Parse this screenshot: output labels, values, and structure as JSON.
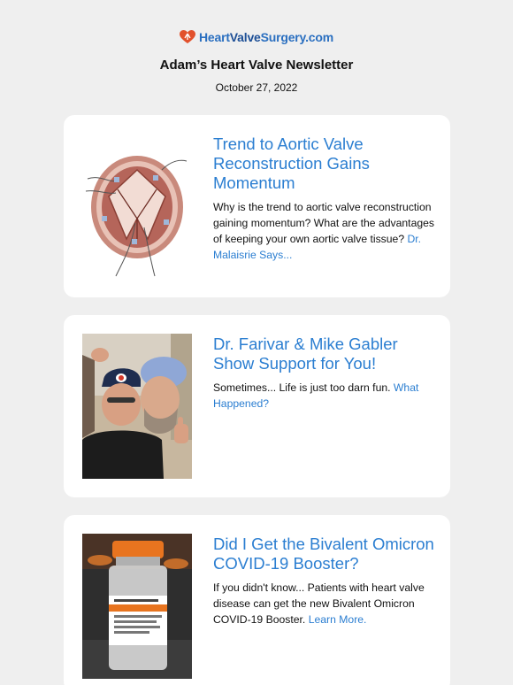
{
  "header": {
    "logo": {
      "part1": "Heart",
      "part2": "Valve",
      "part3": "Surgery.com",
      "icon": "heart-valve-logo-icon",
      "color_primary": "#2a6fc0",
      "color_icon": "#e2512c"
    },
    "title": "Adam’s Heart Valve Newsletter",
    "date": "October 27, 2022"
  },
  "articles": [
    {
      "headline": "Trend to Aortic Valve Reconstruction Gains Momentum",
      "body": "Why is the trend to aortic valve reconstruction gaining momentum? What are the advantages of keeping your own aortic valve tissue?",
      "link": "Dr. Malaisrie Says...",
      "image": "aortic-valve-illustration"
    },
    {
      "headline": "Dr. Farivar & Mike Gabler Show Support for You!",
      "body": "Sometimes... Life is just too darn fun.",
      "link": "What Happened?",
      "image": "doctors-selfie-photo"
    },
    {
      "headline": "Did I Get the Bivalent Omicron COVID-19 Booster?",
      "body": "If you didn't know... Patients with heart valve disease can get the new Bivalent Omicron COVID-19 Booster.",
      "link": "Learn More.",
      "image": "covid-vaccine-vial-photo"
    }
  ],
  "colors": {
    "background": "#efefef",
    "card": "#ffffff",
    "link": "#2b7ed1"
  }
}
